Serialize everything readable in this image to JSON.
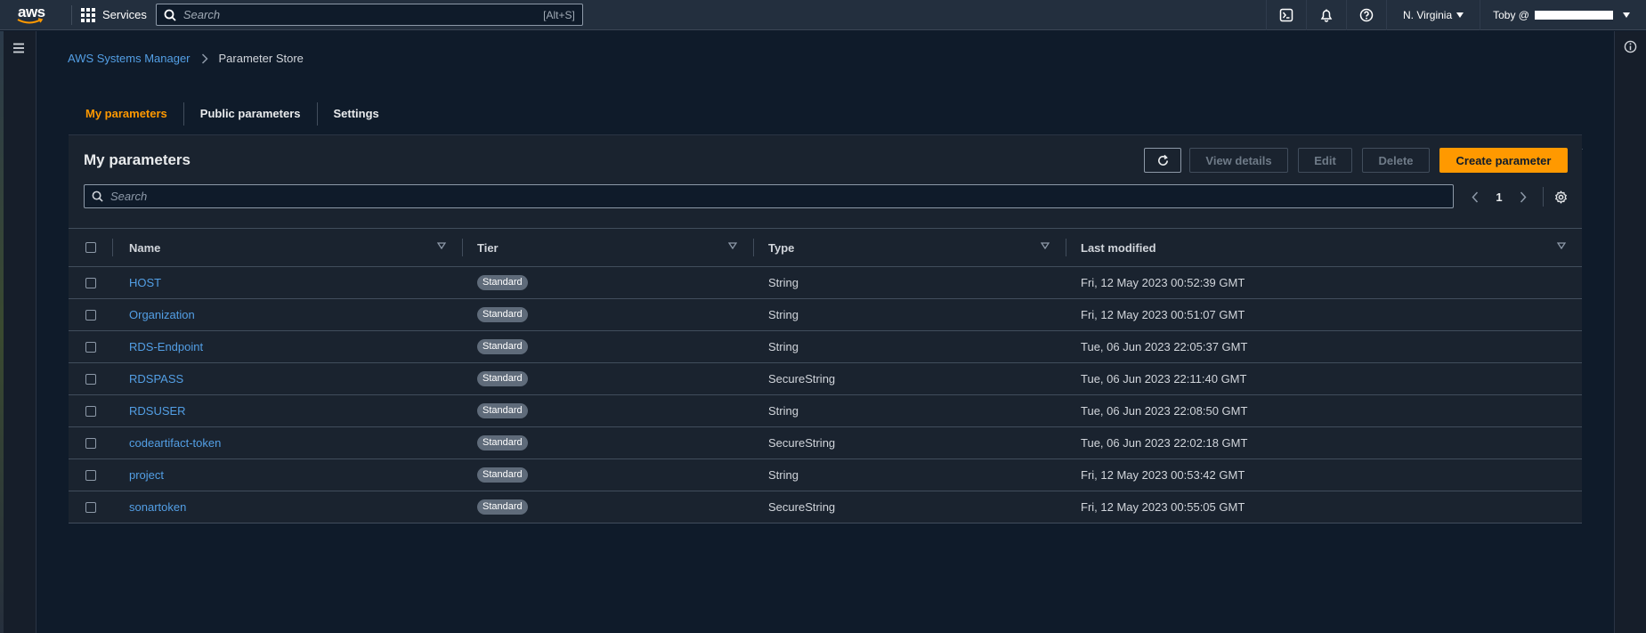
{
  "topnav": {
    "logo": "aws",
    "services_label": "Services",
    "search_placeholder": "Search",
    "search_shortcut": "[Alt+S]",
    "region": "N. Virginia",
    "user": "Toby @"
  },
  "breadcrumb": {
    "parent": "AWS Systems Manager",
    "current": "Parameter Store"
  },
  "tabs": [
    {
      "label": "My parameters",
      "active": true
    },
    {
      "label": "Public parameters",
      "active": false
    },
    {
      "label": "Settings",
      "active": false
    }
  ],
  "panel": {
    "title": "My parameters",
    "buttons": {
      "view_details": "View details",
      "edit": "Edit",
      "delete": "Delete",
      "create": "Create parameter"
    },
    "filter_placeholder": "Search",
    "page": "1"
  },
  "table": {
    "headers": {
      "name": "Name",
      "tier": "Tier",
      "type": "Type",
      "last_modified": "Last modified"
    },
    "rows": [
      {
        "name": "HOST",
        "tier": "Standard",
        "type": "String",
        "last_modified": "Fri, 12 May 2023 00:52:39 GMT"
      },
      {
        "name": "Organization",
        "tier": "Standard",
        "type": "String",
        "last_modified": "Fri, 12 May 2023 00:51:07 GMT"
      },
      {
        "name": "RDS-Endpoint",
        "tier": "Standard",
        "type": "String",
        "last_modified": "Tue, 06 Jun 2023 22:05:37 GMT"
      },
      {
        "name": "RDSPASS",
        "tier": "Standard",
        "type": "SecureString",
        "last_modified": "Tue, 06 Jun 2023 22:11:40 GMT"
      },
      {
        "name": "RDSUSER",
        "tier": "Standard",
        "type": "String",
        "last_modified": "Tue, 06 Jun 2023 22:08:50 GMT"
      },
      {
        "name": "codeartifact-token",
        "tier": "Standard",
        "type": "SecureString",
        "last_modified": "Tue, 06 Jun 2023 22:02:18 GMT"
      },
      {
        "name": "project",
        "tier": "Standard",
        "type": "String",
        "last_modified": "Fri, 12 May 2023 00:53:42 GMT"
      },
      {
        "name": "sonartoken",
        "tier": "Standard",
        "type": "SecureString",
        "last_modified": "Fri, 12 May 2023 00:55:05 GMT"
      }
    ]
  },
  "colors": {
    "accent": "#ff9900",
    "link": "#539fe5",
    "nav_bg": "#232f3e",
    "page_bg": "#0f1b2a",
    "panel_bg": "#1a232f"
  },
  "icons": {
    "menu": "hamburger-icon",
    "services": "grid-icon",
    "search": "search-icon",
    "cloudshell": "terminal-icon",
    "notifications": "bell-icon",
    "help": "help-icon",
    "info": "info-icon",
    "refresh": "refresh-icon",
    "settings": "gear-icon"
  }
}
